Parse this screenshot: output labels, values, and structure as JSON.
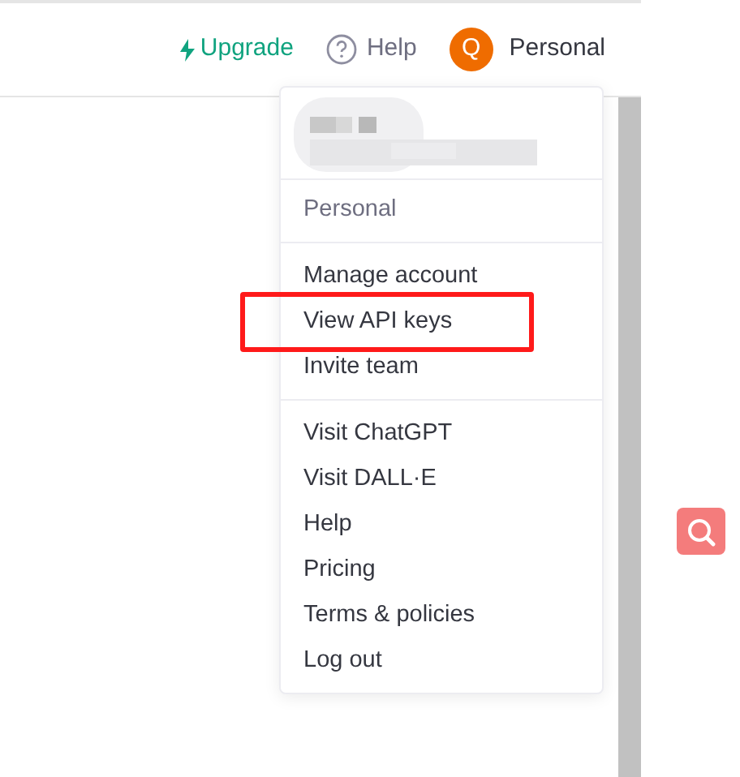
{
  "header": {
    "upgrade": "Upgrade",
    "help": "Help",
    "avatar_letter": "Q",
    "account": "Personal"
  },
  "menu": {
    "sections": [
      {
        "heading": "Personal"
      },
      {
        "items": [
          {
            "label": "Manage account",
            "highlighted": false
          },
          {
            "label": "View API keys",
            "highlighted": true
          },
          {
            "label": "Invite team",
            "highlighted": false
          }
        ]
      },
      {
        "items": [
          {
            "label": "Visit ChatGPT",
            "highlighted": false
          },
          {
            "label": "Visit DALL·E",
            "highlighted": false
          },
          {
            "label": "Help",
            "highlighted": false
          },
          {
            "label": "Pricing",
            "highlighted": false
          },
          {
            "label": "Terms & policies",
            "highlighted": false
          },
          {
            "label": "Log out",
            "highlighted": false
          }
        ]
      }
    ]
  }
}
